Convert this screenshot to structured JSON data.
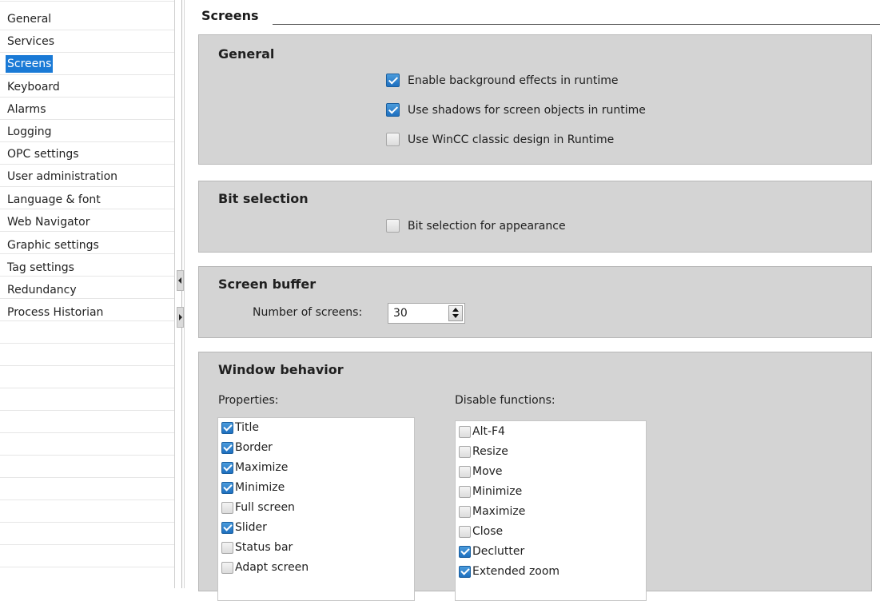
{
  "sidebar": {
    "items": [
      {
        "label": "General",
        "selected": false
      },
      {
        "label": "Services",
        "selected": false
      },
      {
        "label": "Screens",
        "selected": true
      },
      {
        "label": "Keyboard",
        "selected": false
      },
      {
        "label": "Alarms",
        "selected": false
      },
      {
        "label": "Logging",
        "selected": false
      },
      {
        "label": "OPC settings",
        "selected": false
      },
      {
        "label": "User administration",
        "selected": false
      },
      {
        "label": "Language & font",
        "selected": false
      },
      {
        "label": "Web Navigator",
        "selected": false
      },
      {
        "label": "Graphic settings",
        "selected": false
      },
      {
        "label": "Tag settings",
        "selected": false
      },
      {
        "label": "Redundancy",
        "selected": false
      },
      {
        "label": "Process Historian",
        "selected": false
      }
    ]
  },
  "main": {
    "title": "Screens",
    "general": {
      "title": "General",
      "options": [
        {
          "label": "Enable background effects in runtime",
          "checked": true
        },
        {
          "label": "Use shadows for screen objects in runtime",
          "checked": true
        },
        {
          "label": "Use WinCC classic design in Runtime",
          "checked": false
        }
      ]
    },
    "bit_selection": {
      "title": "Bit selection",
      "option": {
        "label": "Bit selection for appearance",
        "checked": false
      }
    },
    "screen_buffer": {
      "title": "Screen buffer",
      "label": "Number of screens:",
      "value": "30"
    },
    "window_behavior": {
      "title": "Window behavior",
      "properties_label": "Properties:",
      "disable_label": "Disable functions:",
      "properties": [
        {
          "label": "Title",
          "checked": true
        },
        {
          "label": "Border",
          "checked": true
        },
        {
          "label": "Maximize",
          "checked": true
        },
        {
          "label": "Minimize",
          "checked": true
        },
        {
          "label": "Full screen",
          "checked": false
        },
        {
          "label": "Slider",
          "checked": true
        },
        {
          "label": "Status bar",
          "checked": false
        },
        {
          "label": "Adapt screen",
          "checked": false
        }
      ],
      "disable_functions": [
        {
          "label": "Alt-F4",
          "checked": false
        },
        {
          "label": "Resize",
          "checked": false
        },
        {
          "label": "Move",
          "checked": false
        },
        {
          "label": "Minimize",
          "checked": false
        },
        {
          "label": "Maximize",
          "checked": false
        },
        {
          "label": "Close",
          "checked": false
        },
        {
          "label": "Declutter",
          "checked": true
        },
        {
          "label": "Extended zoom",
          "checked": true
        }
      ]
    }
  },
  "colors": {
    "selection": "#1a7ad6",
    "panel": "#d4d4d4",
    "checkbox_checked": "#1e6fbf"
  }
}
